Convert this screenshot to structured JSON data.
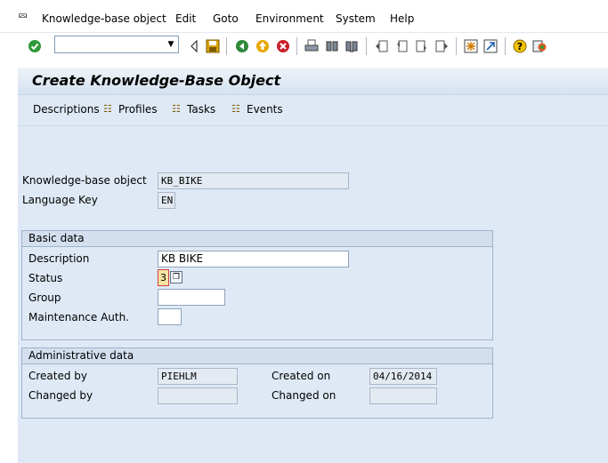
{
  "menu": {
    "items": [
      "Knowledge-base object",
      "Edit",
      "Goto",
      "Environment",
      "System",
      "Help"
    ]
  },
  "toolbar": {
    "command_field_value": "",
    "icons": [
      "enter-icon",
      "back-arrow-icon",
      "save-icon",
      "back-icon",
      "exit-icon",
      "cancel-icon",
      "print-icon",
      "find-icon",
      "find-next-icon",
      "first-page-icon",
      "previous-page-icon",
      "next-page-icon",
      "last-page-icon",
      "create-session-icon",
      "shortcut-icon",
      "help-icon",
      "customize-layout-icon"
    ]
  },
  "page": {
    "title": "Create Knowledge-Base Object"
  },
  "app_toolbar": {
    "descriptions": "Descriptions",
    "profiles": "Profiles",
    "tasks": "Tasks",
    "events": "Events"
  },
  "header_fields": {
    "kb_object_label": "Knowledge-base object",
    "kb_object_value": "KB_BIKE",
    "language_label": "Language Key",
    "language_value": "EN"
  },
  "basic_data": {
    "title": "Basic data",
    "description_label": "Description",
    "description_value": "KB BIKE",
    "status_label": "Status",
    "status_value": "3",
    "group_label": "Group",
    "group_value": "",
    "maint_auth_label": "Maintenance Auth.",
    "maint_auth_value": ""
  },
  "admin_data": {
    "title": "Administrative data",
    "created_by_label": "Created by",
    "created_by_value": "PIEHLM",
    "created_on_label": "Created on",
    "created_on_value": "04/16/2014",
    "changed_by_label": "Changed by",
    "changed_by_value": "",
    "changed_on_label": "Changed on",
    "changed_on_value": ""
  }
}
